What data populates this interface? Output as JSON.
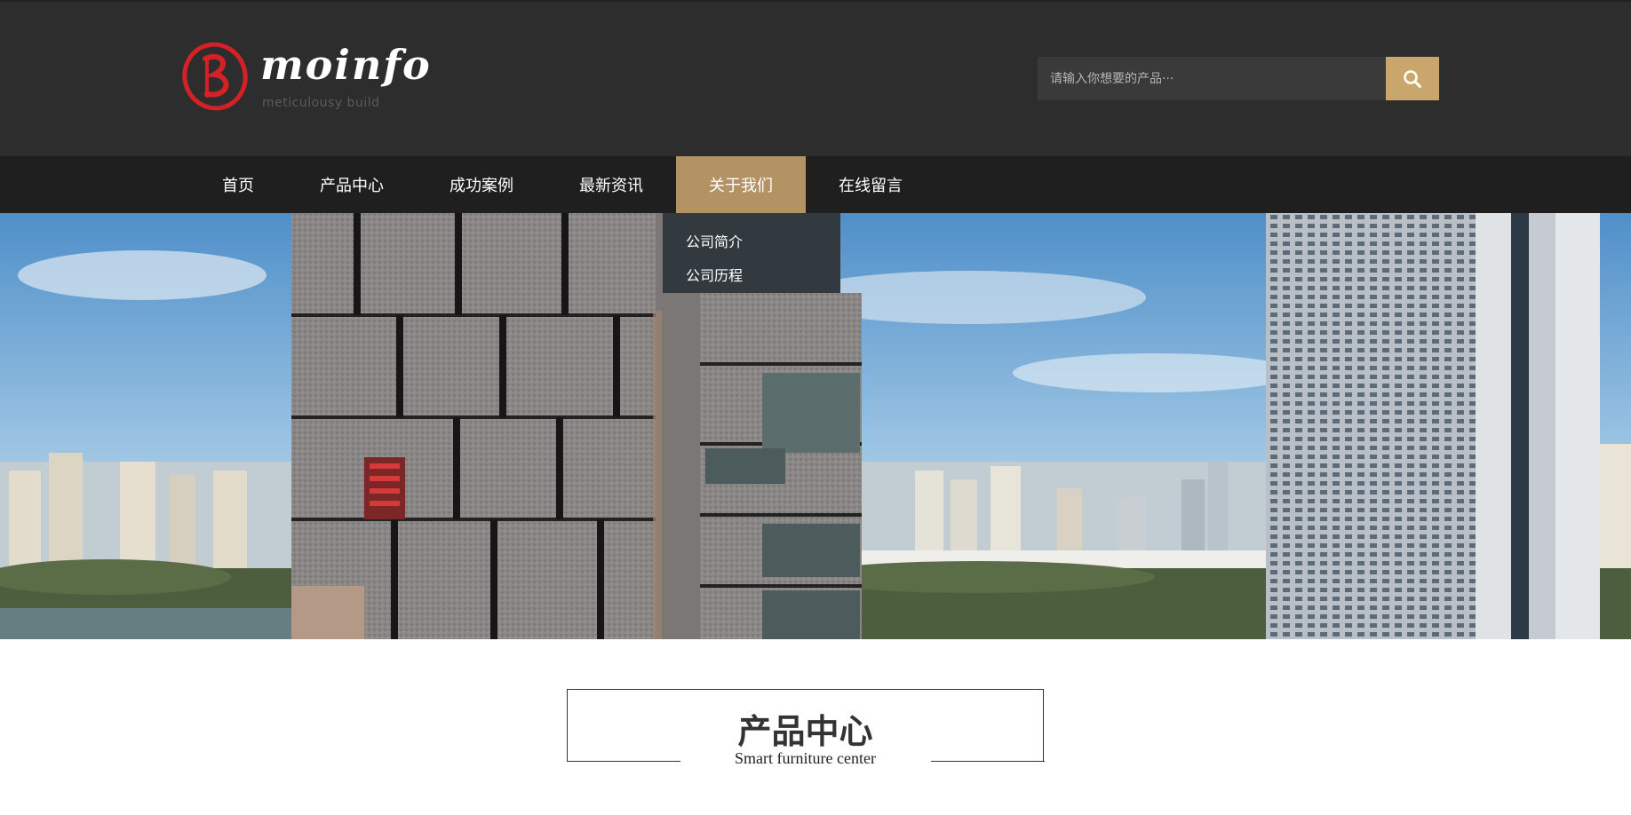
{
  "header": {
    "logo": {
      "brand": "moinfo",
      "tagline": "meticulousy build",
      "mark_color": "#d42126"
    },
    "search": {
      "placeholder": "请输入你想要的产品···",
      "button_icon": "search-icon",
      "button_color": "#c9a66b"
    }
  },
  "nav": {
    "items": [
      {
        "label": "首页"
      },
      {
        "label": "产品中心"
      },
      {
        "label": "成功案例"
      },
      {
        "label": "最新资讯"
      },
      {
        "label": "关于我们"
      },
      {
        "label": "在线留言"
      }
    ],
    "active_index": 4,
    "active_color": "#b39264",
    "dropdown": {
      "items": [
        {
          "label": "公司简介"
        },
        {
          "label": "公司历程"
        }
      ]
    }
  },
  "banner": {
    "description_icon": "city-buildings-image"
  },
  "section": {
    "title_cn": "产品中心",
    "title_en": "Smart furniture center"
  }
}
